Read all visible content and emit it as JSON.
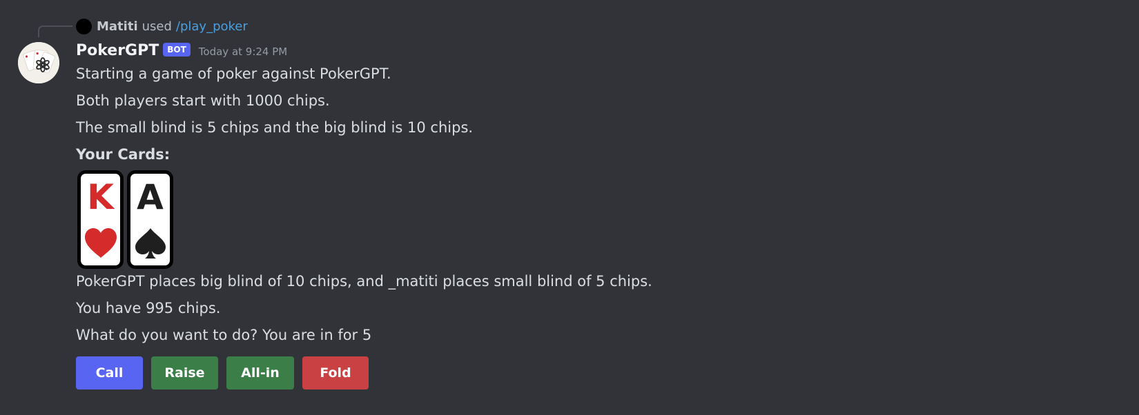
{
  "colors": {
    "background": "#313338",
    "primary_button": "#5865f2",
    "success_button": "#3b7e47",
    "danger_button": "#c94143",
    "link": "#4a9fe0",
    "hearts": "#d52b2b",
    "spades": "#1f1f1f"
  },
  "reply": {
    "user": "Matiti",
    "used_text": "used",
    "command": "/play_poker"
  },
  "author": {
    "name": "PokerGPT",
    "tag": "BOT",
    "timestamp": "Today at 9:24 PM",
    "avatar_icon": "chatgpt-logo-playing-cards-avatar"
  },
  "messages": {
    "line1": "Starting a game of poker against PokerGPT.",
    "line2": "Both players start with 1000 chips.",
    "line3": "The small blind is 5 chips and the big blind is 10 chips.",
    "cards_heading": "Your Cards:",
    "line4": "PokerGPT places big blind of 10 chips, and _matiti places small blind of 5 chips.",
    "line5": "You have 995 chips.",
    "line6": "What do you want to do? You are in for 5"
  },
  "cards": [
    {
      "rank": "K",
      "suit": "hearts",
      "icon": "heart-suit-icon",
      "color": "#d52b2b"
    },
    {
      "rank": "A",
      "suit": "spades",
      "icon": "spade-suit-icon",
      "color": "#1f1f1f"
    }
  ],
  "buttons": {
    "call": "Call",
    "raise": "Raise",
    "allin": "All-in",
    "fold": "Fold"
  }
}
